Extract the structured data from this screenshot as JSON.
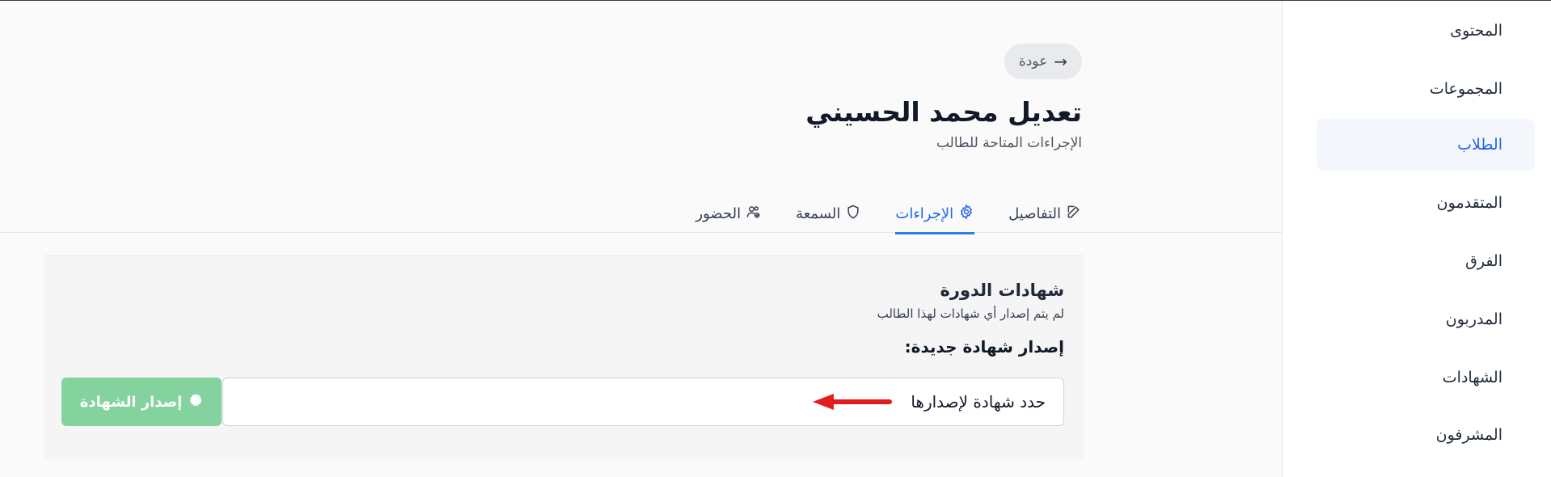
{
  "sidebar": {
    "items": [
      {
        "label": "المحتوى"
      },
      {
        "label": "المجموعات"
      },
      {
        "label": "الطلاب",
        "active": true
      },
      {
        "label": "المتقدمون"
      },
      {
        "label": "الفرق"
      },
      {
        "label": "المدربون"
      },
      {
        "label": "الشهادات"
      },
      {
        "label": "المشرفون"
      }
    ]
  },
  "header": {
    "back_label": "عودة",
    "title": "تعديل محمد الحسيني",
    "subtitle": "الإجراءات المتاحة للطالب"
  },
  "tabs": [
    {
      "label": "التفاصيل",
      "icon": "edit-icon"
    },
    {
      "label": "الإجراءات",
      "icon": "gear-icon",
      "active": true
    },
    {
      "label": "السمعة",
      "icon": "shield-icon"
    },
    {
      "label": "الحضور",
      "icon": "users-icon"
    }
  ],
  "certificates": {
    "title": "شهادات الدورة",
    "description": "لم يتم إصدار أي شهادات لهذا الطالب",
    "new_label": "إصدار شهادة جديدة:",
    "select_placeholder": "حدد شهادة لإصدارها",
    "issue_button": "إصدار الشهادة"
  },
  "colors": {
    "accent": "#2563eb",
    "issue_button_bg": "#84d39f",
    "annotation_arrow": "#e11d1d"
  }
}
